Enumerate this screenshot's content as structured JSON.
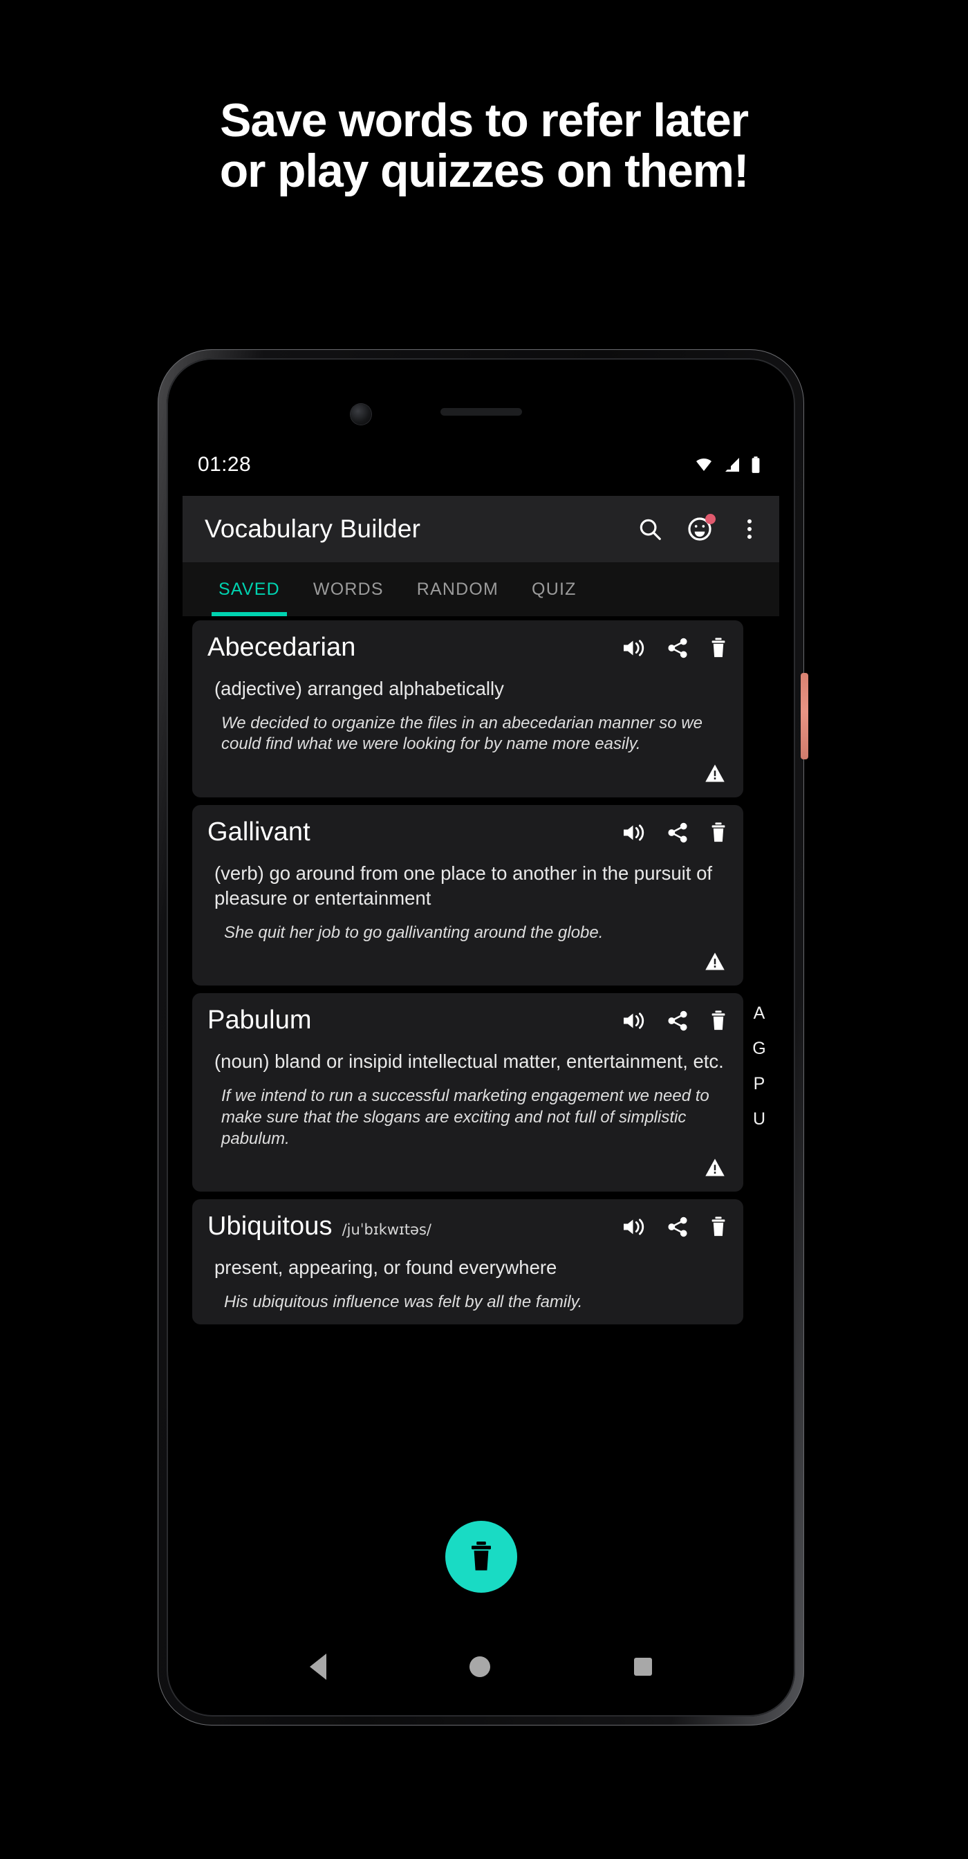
{
  "headline": {
    "line1": "Save words to refer later",
    "line2": "or play quizzes on them!"
  },
  "colors": {
    "accent_teal": "#00d3b0",
    "fab_teal": "#19dbc4",
    "badge_red": "#e05a6e",
    "side_button": "#e08b7b",
    "card_bg": "#1c1c1e",
    "appbar_bg": "#232325"
  },
  "status_bar": {
    "time": "01:28",
    "icons": [
      "wifi-icon",
      "cellular-signal-icon",
      "battery-icon"
    ]
  },
  "app_bar": {
    "title": "Vocabulary Builder",
    "actions": [
      {
        "name": "search-icon",
        "label": "Search"
      },
      {
        "name": "smiley-icon",
        "label": "Feedback",
        "badge": true
      },
      {
        "name": "overflow-menu-icon",
        "label": "More options"
      }
    ]
  },
  "tabs": [
    {
      "label": "SAVED",
      "active": true
    },
    {
      "label": "WORDS",
      "active": false
    },
    {
      "label": "RANDOM",
      "active": false
    },
    {
      "label": "QUIZ",
      "active": false
    }
  ],
  "card_actions": [
    {
      "name": "volume-icon",
      "label": "Pronounce"
    },
    {
      "name": "share-icon",
      "label": "Share"
    },
    {
      "name": "delete-icon",
      "label": "Delete"
    }
  ],
  "words": [
    {
      "word": "Abecedarian",
      "phonetic": "",
      "definition": "(adjective) arranged alphabetically",
      "example": "We decided to organize the files in an abecedarian manner so we could find what we were looking for by name more easily.",
      "warning": true
    },
    {
      "word": "Gallivant",
      "phonetic": "",
      "definition": "(verb) go around from one place to another in the pursuit of pleasure or entertainment",
      "example": "She quit her job to go gallivanting around the globe.",
      "warning": true
    },
    {
      "word": "Pabulum",
      "phonetic": "",
      "definition": "(noun) bland or insipid intellectual matter, entertainment, etc.",
      "example": "If we intend to run a successful marketing engagement we need to make sure that the slogans are exciting and not full of simplistic pabulum.",
      "warning": true
    },
    {
      "word": "Ubiquitous",
      "phonetic": "/juˈbɪkwɪtəs/",
      "definition": "present, appearing, or found everywhere",
      "example": "His ubiquitous influence was felt by all the family.",
      "warning": false
    }
  ],
  "alphabet_index": [
    "A",
    "G",
    "P",
    "U"
  ],
  "fab": {
    "name": "delete-fab",
    "icon": "trash-icon",
    "label": "Delete selected"
  },
  "nav_bar": [
    {
      "name": "nav-back-button",
      "label": "Back"
    },
    {
      "name": "nav-home-button",
      "label": "Home"
    },
    {
      "name": "nav-recents-button",
      "label": "Recents"
    }
  ]
}
